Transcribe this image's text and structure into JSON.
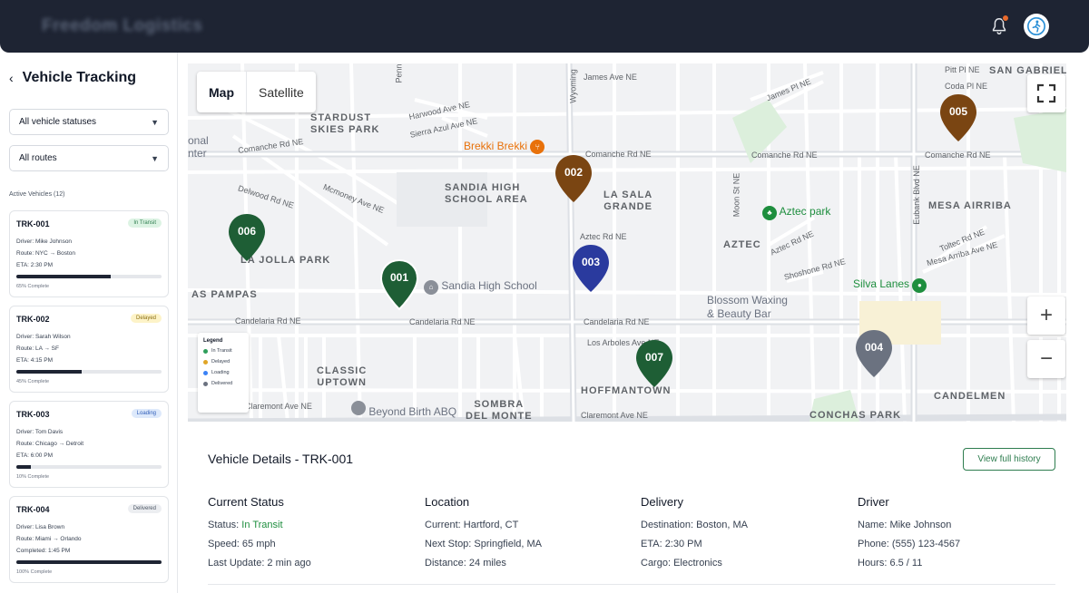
{
  "app": {
    "title": "Freedom Logistics",
    "notification_icon": "bell-icon",
    "avatar_icon": "runner-avatar-icon"
  },
  "sidebar": {
    "title": "Vehicle Tracking",
    "status_filter": "All vehicle statuses",
    "route_filter": "All routes",
    "active_label": "Active Vehicles (12)",
    "vehicles": [
      {
        "id": "TRK-001",
        "status": "In Transit",
        "driver": "Driver: Mike Johnson",
        "route": "Route: NYC → Boston",
        "eta": "ETA: 2:30 PM",
        "progress": 0.65,
        "progress_label": "65% Complete"
      },
      {
        "id": "TRK-002",
        "status": "Delayed",
        "driver": "Driver: Sarah Wilson",
        "route": "Route: LA → SF",
        "eta": "ETA: 4:15 PM",
        "progress": 0.45,
        "progress_label": "45% Complete"
      },
      {
        "id": "TRK-003",
        "status": "Loading",
        "driver": "Driver: Tom Davis",
        "route": "Route: Chicago → Detroit",
        "eta": "ETA: 6:00 PM",
        "progress": 0.1,
        "progress_label": "10% Complete"
      },
      {
        "id": "TRK-004",
        "status": "Delivered",
        "driver": "Driver: Lisa Brown",
        "route": "Route: Miami → Orlando",
        "eta": "Completed: 1:45 PM",
        "progress": 1.0,
        "progress_label": "100% Complete"
      }
    ]
  },
  "map": {
    "type_map": "Map",
    "type_satellite": "Satellite",
    "zoom_in": "+",
    "zoom_out": "−",
    "areas": [
      "STARDUST\nSKIES PARK",
      "SANDIA HIGH\nSCHOOL AREA",
      "LA SALA\nGRANDE",
      "MESA AIRRIBA",
      "AZTEC",
      "LA JOLLA PARK",
      "AS PAMPAS",
      "CLASSIC\nUPTOWN",
      "SOMBRA\nDEL MONTE",
      "HOFFMANTOWN",
      "CANDELMEN",
      "CONCHAS PARK",
      "SAN GABRIEL"
    ],
    "streets": [
      "James Ave NE",
      "Harwood Ave NE",
      "Sierra Azul Ave NE",
      "Comanche Rd NE",
      "Comanche Rd NE",
      "Comanche Rd NE",
      "Comanche Rd NE",
      "Delwood Rd NE",
      "Mcmoney Ave NE",
      "Candelaria Rd NE",
      "Candelaria Rd NE",
      "Candelaria Rd NE",
      "Los Arboles Ave NE",
      "Claremont Ave NE",
      "Aztec Rd NE",
      "Aztec Rd NE",
      "Shoshone Rd NE",
      "Toltec Rd NE",
      "Mesa Arriba Ave NE",
      "Moon St NE",
      "Eubank Blvd NE",
      "Wyoming",
      "Penn",
      "Coda Pl NE",
      "Pitt Pl NE",
      "James Pl NE",
      "Claremont Ave NE"
    ],
    "pois": [
      "Brekki Brekki",
      "Sandia High School",
      "Aztec park",
      "Silva Lanes",
      "Blossom Waxing\n& Beauty Bar",
      "Beyond Birth ABQ",
      "onal\nnter"
    ],
    "markers": [
      {
        "label": "001",
        "status": "In Transit"
      },
      {
        "label": "002",
        "status": "Delayed"
      },
      {
        "label": "003",
        "status": "Loading"
      },
      {
        "label": "004",
        "status": "Delivered"
      },
      {
        "label": "005",
        "status": "Delayed"
      },
      {
        "label": "006",
        "status": "In Transit"
      },
      {
        "label": "007",
        "status": "In Transit"
      }
    ],
    "legend": {
      "title": "Legend",
      "items": [
        {
          "label": "In Transit",
          "color": "#2e9e5b"
        },
        {
          "label": "Delayed",
          "color": "#e0a526"
        },
        {
          "label": "Loading",
          "color": "#3b82f6"
        },
        {
          "label": "Delivered",
          "color": "#6b7280"
        }
      ]
    }
  },
  "details": {
    "title": "Vehicle Details - TRK-001",
    "history_button": "View full history",
    "current_status": {
      "heading": "Current Status",
      "status_prefix": "Status: ",
      "status_value": "In Transit",
      "speed": "Speed: 65 mph",
      "last_update": "Last Update: 2 min ago"
    },
    "location": {
      "heading": "Location",
      "current": "Current: Hartford, CT",
      "next_stop": "Next Stop: Springfield, MA",
      "distance": "Distance: 24 miles"
    },
    "delivery": {
      "heading": "Delivery",
      "destination": "Destination: Boston, MA",
      "eta": "ETA: 2:30 PM",
      "cargo": "Cargo: Electronics"
    },
    "driver": {
      "heading": "Driver",
      "name": "Name: Mike Johnson",
      "phone": "Phone: (555) 123-4567",
      "hours": "Hours: 6.5 / 11"
    }
  },
  "colors": {
    "dark": "#1e2433",
    "transit_pin": "#1e5e35",
    "delayed_pin": "#7a4512",
    "loading_pin": "#2a3a9e",
    "delivered_pin": "#6b7280"
  }
}
